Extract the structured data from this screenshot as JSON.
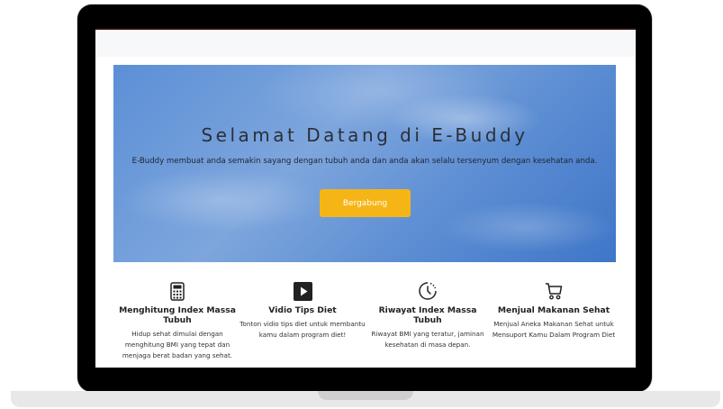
{
  "hero": {
    "title": "Selamat Datang di E-Buddy",
    "subtitle": "E-Buddy membuat anda semakin sayang dengan tubuh anda dan anda akan selalu tersenyum dengan kesehatan anda.",
    "button_label": "Bergabung",
    "button_color": "#f6b516"
  },
  "features": [
    {
      "icon": "calculator-icon",
      "title": "Menghitung Index Massa Tubuh",
      "description": "Hidup sehat dimulai dengan menghitung BMI yang tepat dan menjaga berat badan yang sehat."
    },
    {
      "icon": "play-icon",
      "title": "Vidio Tips Diet",
      "description": "Tonton vidio tips diet untuk membantu kamu dalam program diet!"
    },
    {
      "icon": "clock-icon",
      "title": "Riwayat Index Massa Tubuh",
      "description": "Riwayat BMI yang teratur, jaminan kesehatan di masa depan."
    },
    {
      "icon": "cart-icon",
      "title": "Menjual Makanan Sehat",
      "description": "Menjual Aneka Makanan Sehat untuk Mensuport Kamu Dalam Program Diet"
    }
  ]
}
